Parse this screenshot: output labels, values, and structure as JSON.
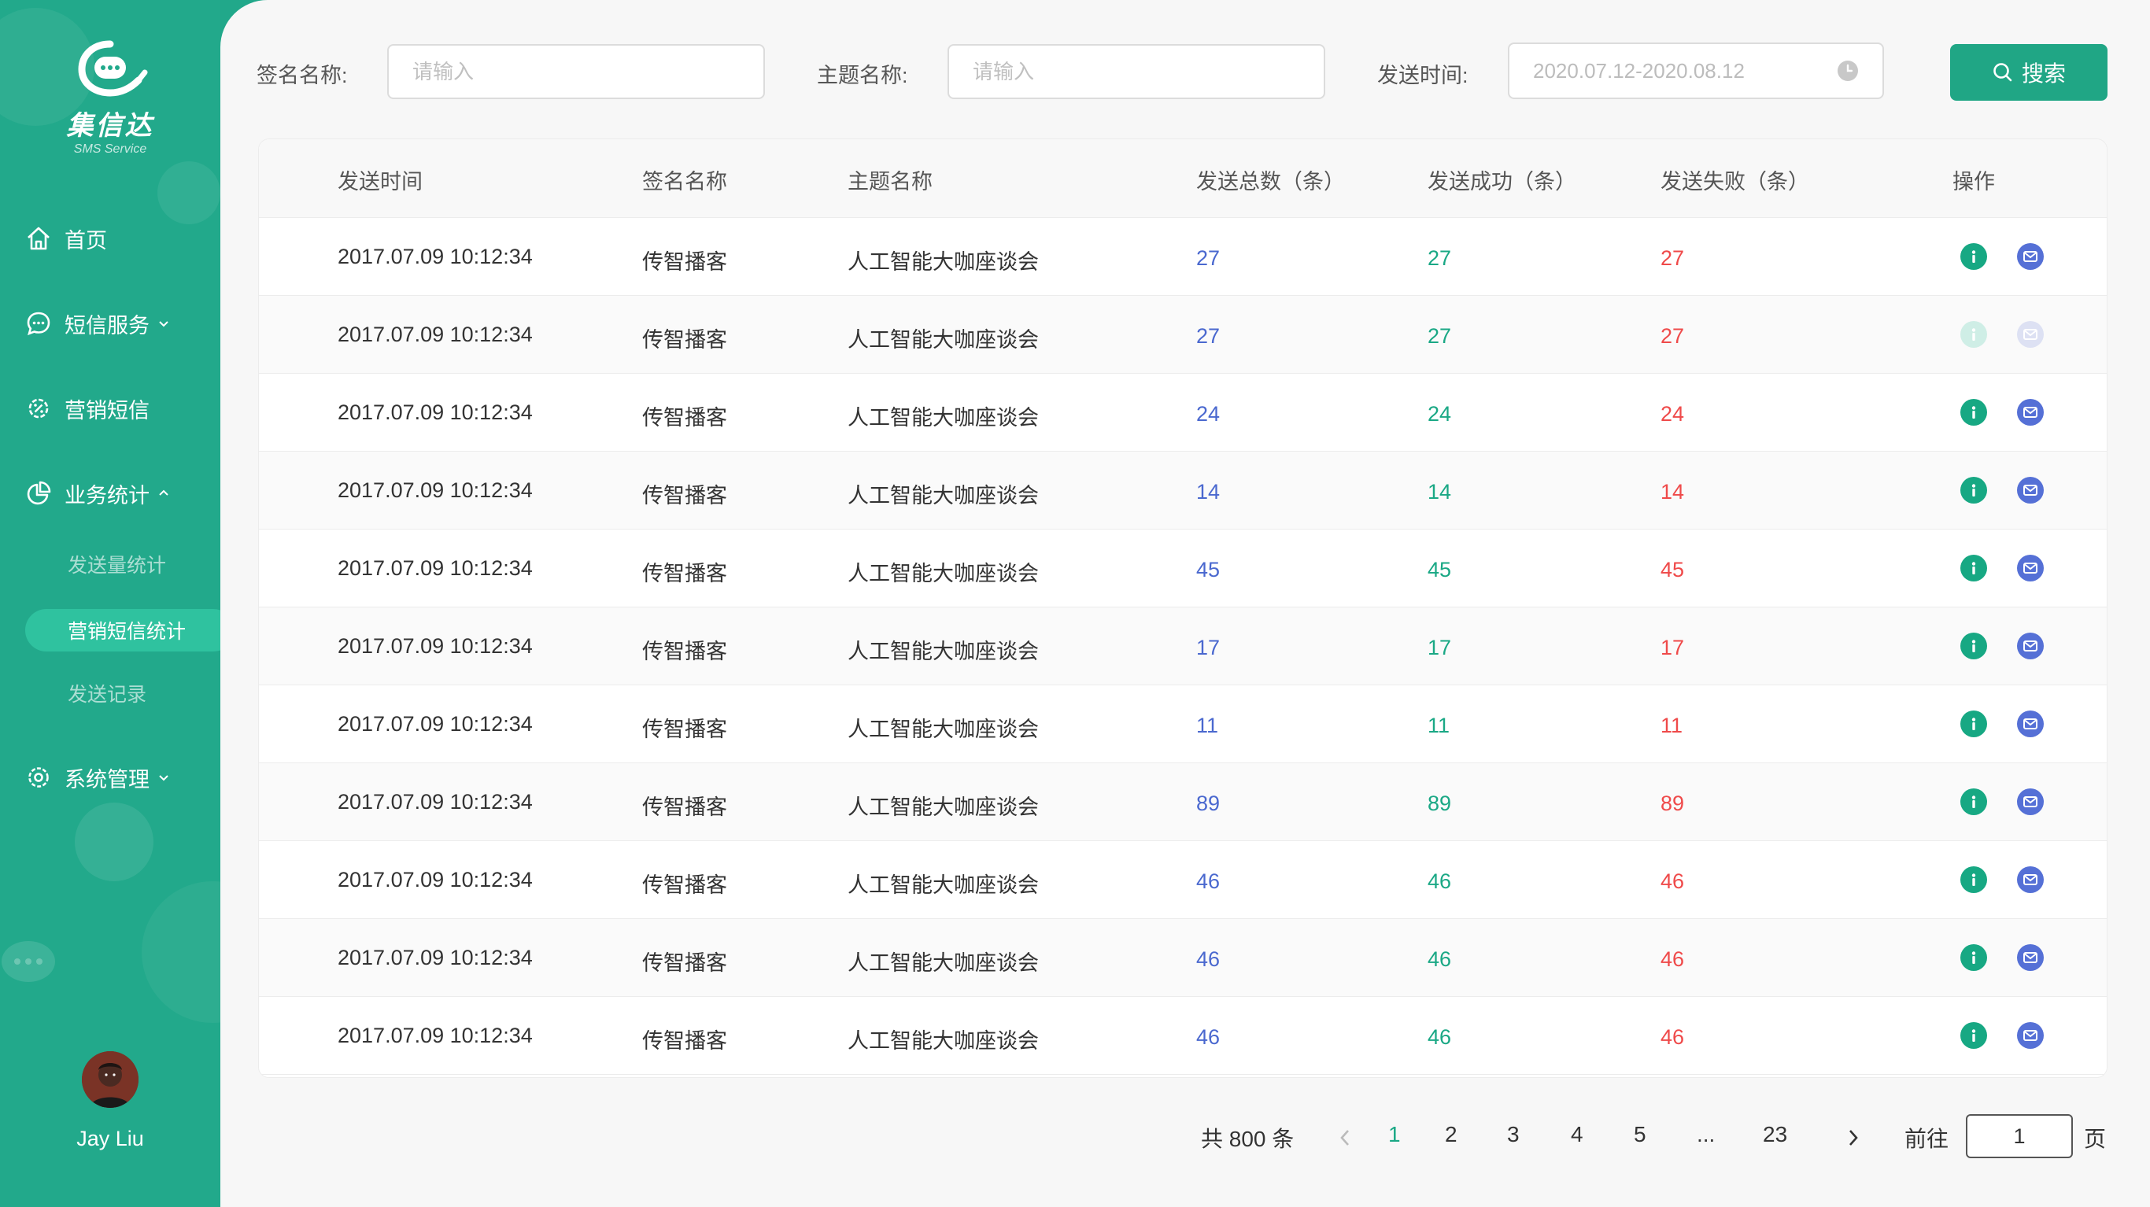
{
  "brand": {
    "name": "集信达",
    "tagline": "SMS Service"
  },
  "colors": {
    "sidebar": "#22a98b",
    "accent": "#20a685",
    "total": "#4a68cf",
    "success": "#1aa885",
    "fail": "#ef4a4a"
  },
  "nav": {
    "home": "首页",
    "sms_service": "短信服务",
    "marketing_sms": "营销短信",
    "business_stats": "业务统计",
    "stats_children": [
      "发送量统计",
      "营销短信统计",
      "发送记录"
    ],
    "system": "系统管理"
  },
  "user": {
    "name": "Jay Liu"
  },
  "filters": {
    "sign_label": "签名名称:",
    "sign_placeholder": "请输入",
    "topic_label": "主题名称:",
    "topic_placeholder": "请输入",
    "time_label": "发送时间:",
    "time_value": "2020.07.12-2020.08.12",
    "search": "搜索"
  },
  "table": {
    "headers": [
      "发送时间",
      "签名名称",
      "主题名称",
      "发送总数（条）",
      "发送成功（条）",
      "发送失败（条）",
      "操作"
    ],
    "rows": [
      {
        "time": "2017.07.09 10:12:34",
        "sign": "传智播客",
        "topic": "人工智能大咖座谈会",
        "total": "27",
        "success": "27",
        "fail": "27",
        "disabled": false
      },
      {
        "time": "2017.07.09 10:12:34",
        "sign": "传智播客",
        "topic": "人工智能大咖座谈会",
        "total": "27",
        "success": "27",
        "fail": "27",
        "disabled": true
      },
      {
        "time": "2017.07.09 10:12:34",
        "sign": "传智播客",
        "topic": "人工智能大咖座谈会",
        "total": "24",
        "success": "24",
        "fail": "24",
        "disabled": false
      },
      {
        "time": "2017.07.09 10:12:34",
        "sign": "传智播客",
        "topic": "人工智能大咖座谈会",
        "total": "14",
        "success": "14",
        "fail": "14",
        "disabled": false
      },
      {
        "time": "2017.07.09 10:12:34",
        "sign": "传智播客",
        "topic": "人工智能大咖座谈会",
        "total": "45",
        "success": "45",
        "fail": "45",
        "disabled": false
      },
      {
        "time": "2017.07.09 10:12:34",
        "sign": "传智播客",
        "topic": "人工智能大咖座谈会",
        "total": "17",
        "success": "17",
        "fail": "17",
        "disabled": false
      },
      {
        "time": "2017.07.09 10:12:34",
        "sign": "传智播客",
        "topic": "人工智能大咖座谈会",
        "total": "11",
        "success": "11",
        "fail": "11",
        "disabled": false
      },
      {
        "time": "2017.07.09 10:12:34",
        "sign": "传智播客",
        "topic": "人工智能大咖座谈会",
        "total": "89",
        "success": "89",
        "fail": "89",
        "disabled": false
      },
      {
        "time": "2017.07.09 10:12:34",
        "sign": "传智播客",
        "topic": "人工智能大咖座谈会",
        "total": "46",
        "success": "46",
        "fail": "46",
        "disabled": false
      },
      {
        "time": "2017.07.09 10:12:34",
        "sign": "传智播客",
        "topic": "人工智能大咖座谈会",
        "total": "46",
        "success": "46",
        "fail": "46",
        "disabled": false
      },
      {
        "time": "2017.07.09 10:12:34",
        "sign": "传智播客",
        "topic": "人工智能大咖座谈会",
        "total": "46",
        "success": "46",
        "fail": "46",
        "disabled": false
      }
    ]
  },
  "pagination": {
    "total_text": "共 800 条",
    "pages": [
      "1",
      "2",
      "3",
      "4",
      "5",
      "...",
      "23"
    ],
    "current": "1",
    "goto_label": "前往",
    "goto_value": "1",
    "unit": "页"
  }
}
